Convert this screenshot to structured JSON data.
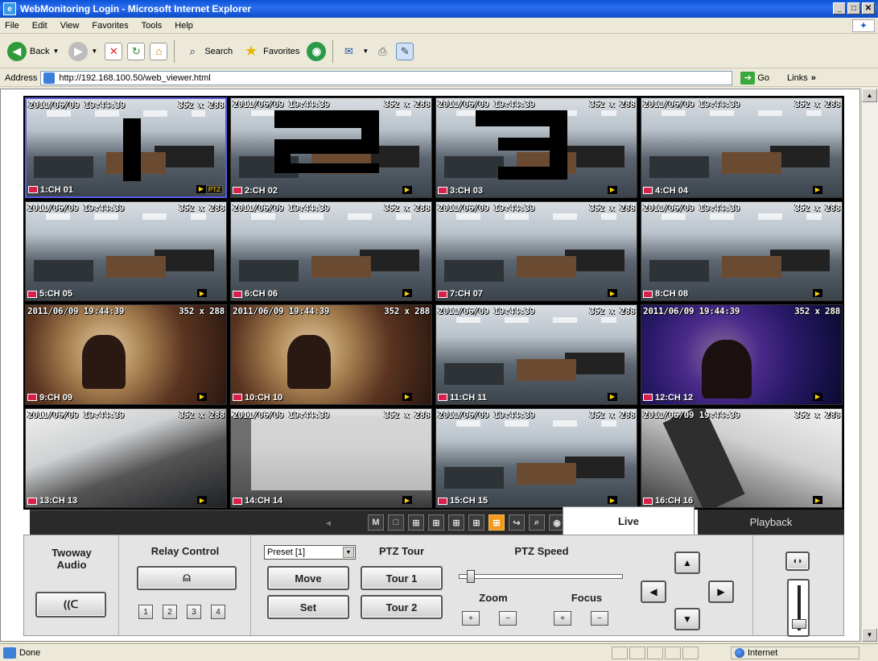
{
  "window": {
    "title": "WebMonitoring Login - Microsoft Internet Explorer",
    "buttons": [
      "_",
      "□",
      "✕"
    ]
  },
  "menu": [
    "File",
    "Edit",
    "View",
    "Favorites",
    "Tools",
    "Help"
  ],
  "toolbar": {
    "back": "Back",
    "search": "Search",
    "favorites": "Favorites"
  },
  "address": {
    "label": "Address",
    "url": "http://192.168.100.50/web_viewer.html",
    "go": "Go",
    "links": "Links"
  },
  "cameras": [
    {
      "ts": "2011/06/09 19:44:39",
      "res": "352 x 288",
      "label": "1:CH 01",
      "feed": "office",
      "ptz": "PTZ"
    },
    {
      "ts": "2011/06/09 19:44:39",
      "res": "352 x 288",
      "label": "2:CH 02",
      "feed": "office"
    },
    {
      "ts": "2011/06/09 19:44:39",
      "res": "352 x 288",
      "label": "3:CH 03",
      "feed": "office"
    },
    {
      "ts": "2011/06/09 19:44:39",
      "res": "352 x 288",
      "label": "4:CH 04",
      "feed": "office"
    },
    {
      "ts": "2011/06/09 19:44:39",
      "res": "352 x 288",
      "label": "5:CH 05",
      "feed": "office"
    },
    {
      "ts": "2011/06/09 19:44:39",
      "res": "352 x 288",
      "label": "6:CH 06",
      "feed": "office"
    },
    {
      "ts": "2011/06/09 19:44:39",
      "res": "352 x 288",
      "label": "7:CH 07",
      "feed": "office"
    },
    {
      "ts": "2011/06/09 19:44:39",
      "res": "352 x 288",
      "label": "8:CH 08",
      "feed": "office"
    },
    {
      "ts": "2011/06/09 19:44:39",
      "res": "352 x 288",
      "label": "9:CH 09",
      "feed": "warm"
    },
    {
      "ts": "2011/06/09 19:44:39",
      "res": "352 x 288",
      "label": "10:CH 10",
      "feed": "warm"
    },
    {
      "ts": "2011/06/09 19:44:39",
      "res": "352 x 288",
      "label": "11:CH 11",
      "feed": "office"
    },
    {
      "ts": "2011/06/09 19:44:39",
      "res": "352 x 288",
      "label": "12:CH 12",
      "feed": "stage"
    },
    {
      "ts": "2011/06/09 19:44:39",
      "res": "352 x 288",
      "label": "13:CH 13",
      "feed": "lab"
    },
    {
      "ts": "2011/06/09 19:44:39",
      "res": "352 x 288",
      "label": "14:CH 14",
      "feed": "grey"
    },
    {
      "ts": "2011/06/09 19:44:39",
      "res": "352 x 288",
      "label": "15:CH 15",
      "feed": "office"
    },
    {
      "ts": "2011/06/09 19:44:39",
      "res": "352 x 288",
      "label": "16:CH 16",
      "feed": "closeup"
    }
  ],
  "view_controls": [
    "◂",
    "M",
    "□",
    "⊞",
    "⊞",
    "⊞",
    "⊞",
    "⊞",
    "↪",
    "⌕",
    "◉",
    "▣"
  ],
  "active_view_control": 7,
  "tabs": {
    "live": "Live",
    "playback": "Playback"
  },
  "panel": {
    "twoway": "Twoway\nAudio",
    "relay_title": "Relay Control",
    "relay_numbers": [
      "1",
      "2",
      "3",
      "4"
    ],
    "preset_value": "Preset [1]",
    "move": "Move",
    "set": "Set",
    "ptz_tour_title": "PTZ Tour",
    "tour1": "Tour 1",
    "tour2": "Tour 2",
    "ptz_speed_title": "PTZ Speed",
    "ptz_speed_level": 0.05,
    "zoom": "Zoom",
    "focus": "Focus",
    "plus": "+",
    "minus": "−"
  },
  "status": {
    "text": "Done",
    "zone": "Internet"
  },
  "colors": {
    "rec": "#d8204a",
    "active": "#f29a1a",
    "title_bar": "#0a53d6"
  }
}
